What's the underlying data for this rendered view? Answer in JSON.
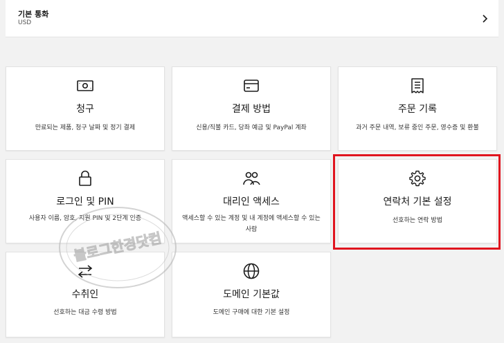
{
  "currency": {
    "title": "기본 통화",
    "value": "USD",
    "chevron_icon": "chevron-right-icon"
  },
  "cards": [
    {
      "icon": "banknote-icon",
      "title": "청구",
      "desc": "만료되는 제품, 청구 날짜 및 정기 결제"
    },
    {
      "icon": "credit-card-icon",
      "title": "결제 방법",
      "desc": "신용/직불 카드, 당좌 예금 및 PayPal 계좌"
    },
    {
      "icon": "receipt-icon",
      "title": "주문 기록",
      "desc": "과거 주문 내역, 보류 중인 주문, 영수증 및 환불"
    },
    {
      "icon": "lock-icon",
      "title": "로그인 및 PIN",
      "desc": "사용자 이름, 암호, 지원 PIN 및 2단계 인증"
    },
    {
      "icon": "people-icon",
      "title": "대리인 액세스",
      "desc": "액세스할 수 있는 계정 및 내 계정에 액세스할 수 있는 사람"
    },
    {
      "icon": "gear-icon",
      "title": "연락처 기본 설정",
      "desc": "선호하는 연락 방법"
    },
    {
      "icon": "transfer-arrows-icon",
      "title": "수취인",
      "desc": "선호하는 대금 수령 방법"
    },
    {
      "icon": "globe-icon",
      "title": "도메인 기본값",
      "desc": "도메인 구매에 대한 기본 설정"
    }
  ],
  "watermark": {
    "text": "블로그한경닷컴"
  },
  "colors": {
    "highlight": "#e0141e",
    "card_bg": "#ffffff",
    "page_bg": "#f2f2f2"
  }
}
